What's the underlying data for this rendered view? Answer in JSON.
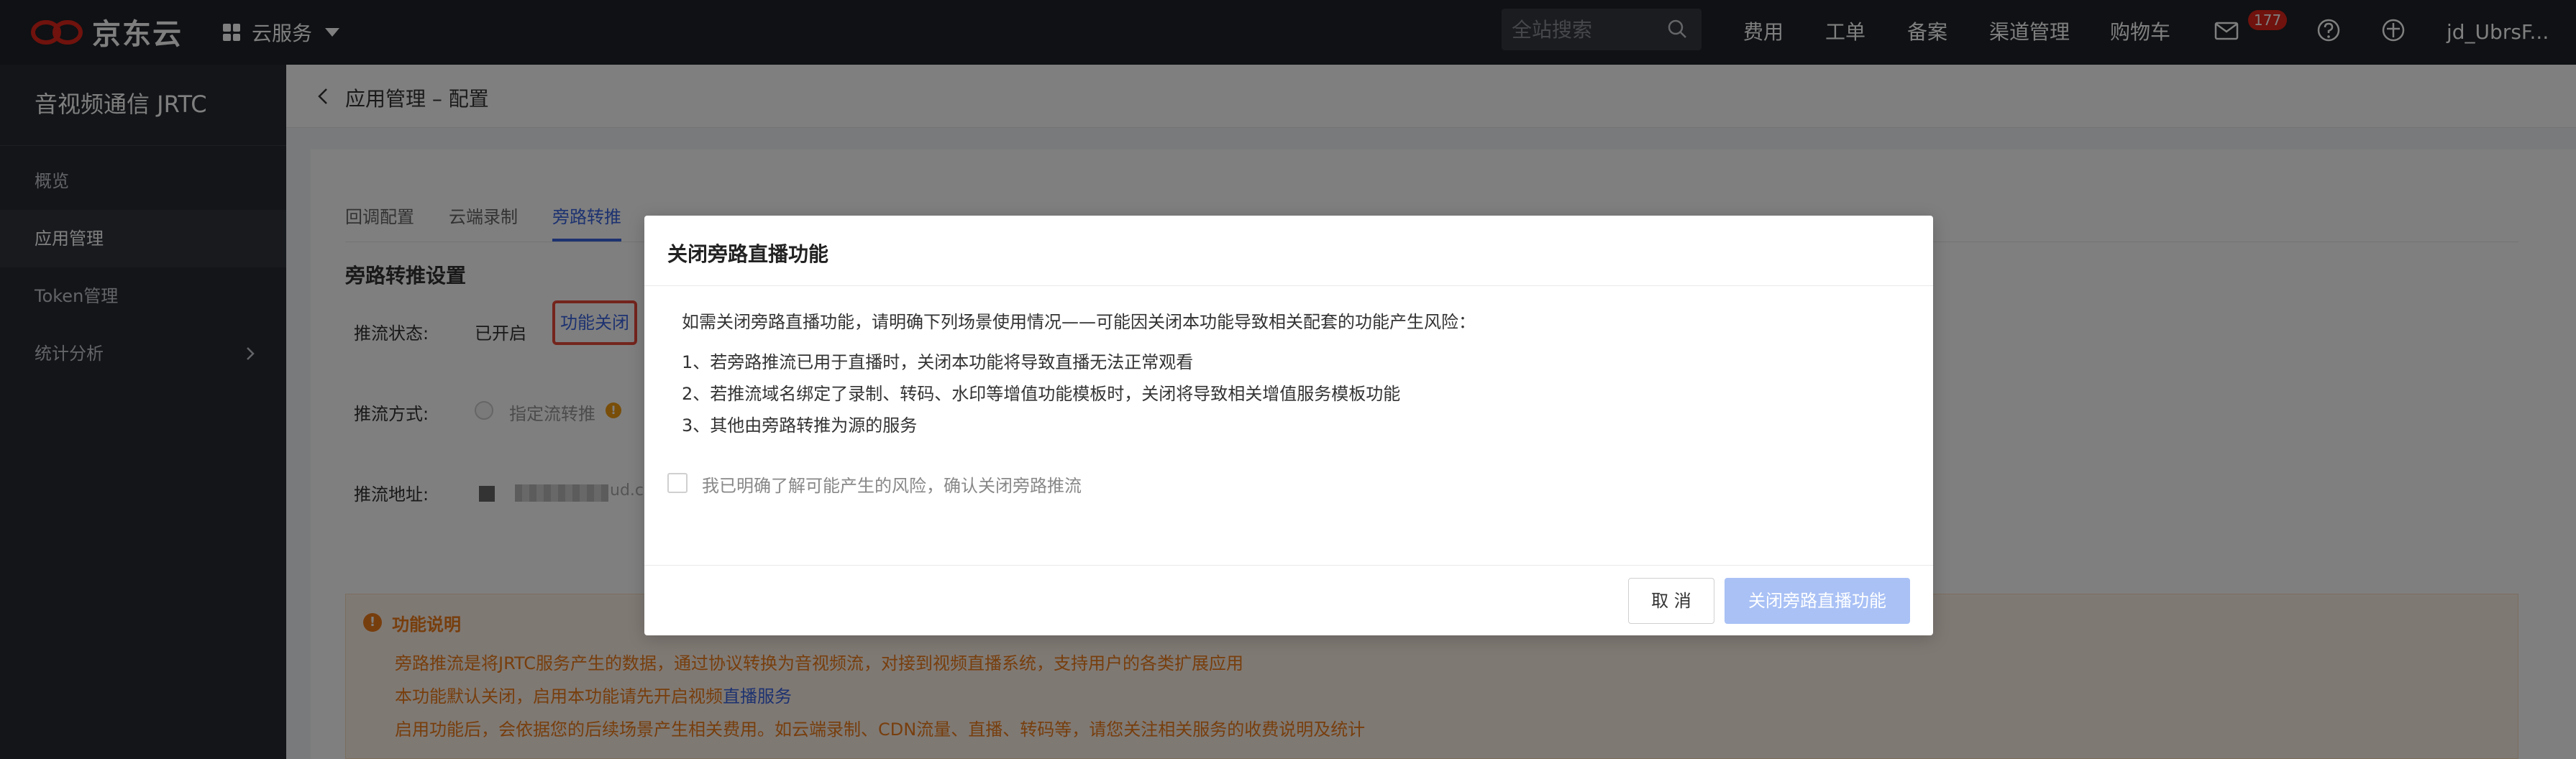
{
  "topbar": {
    "logo_text": "京东云",
    "service_menu_label": "云服务",
    "search_placeholder": "全站搜索",
    "nav_items": [
      "费用",
      "工单",
      "备案",
      "渠道管理",
      "购物车"
    ],
    "mail_badge_count": "177",
    "username": "jd_UbrsF..."
  },
  "sidebar": {
    "title": "音视频通信 JRTC",
    "items": [
      {
        "label": "概览"
      },
      {
        "label": "应用管理"
      },
      {
        "label": "Token管理"
      },
      {
        "label": "统计分析"
      }
    ]
  },
  "breadcrumb": "应用管理 – 配置",
  "tabs": [
    "回调配置",
    "云端录制",
    "旁路转推"
  ],
  "section_title": "旁路转推设置",
  "form": {
    "status_label": "推流状态:",
    "status_value": "已开启",
    "close_button": "功能关闭",
    "method_label": "推流方式:",
    "method_option": "指定流转推",
    "address_label": "推流地址:",
    "address_tail": "ud.c"
  },
  "notice": {
    "title": "功能说明",
    "line1": "旁路推流是将JRTC服务产生的数据，通过协议转换为音视频流，对接到视频直播系统，支持用户的各类扩展应用",
    "line2_prefix": "本功能默认关闭，启用本功能请先开启视频",
    "line2_link": "直播服务",
    "line3": "启用功能后，会依据您的后续场景产生相关费用。如云端录制、CDN流量、直播、转码等，请您关注相关服务的收费说明及统计"
  },
  "modal": {
    "title": "关闭旁路直播功能",
    "intro": "如需关闭旁路直播功能，请明确下列场景使用情况——可能因关闭本功能导致相关配套的功能产生风险：",
    "item1": "1、若旁路推流已用于直播时，关闭本功能将导致直播无法正常观看",
    "item2": "2、若推流域名绑定了录制、转码、水印等增值功能模板时，关闭将导致相关增值服务模板功能",
    "item3": "3、其他由旁路转推为源的服务",
    "checkbox_label": "我已明确了解可能产生的风险，确认关闭旁路推流",
    "cancel_label": "取 消",
    "confirm_label": "关闭旁路直播功能"
  },
  "colors": {
    "accent": "#3a64e0",
    "brand_red": "#e1251b",
    "warning": "#ef7d1a",
    "confirm_disabled": "#a9c1f5"
  }
}
